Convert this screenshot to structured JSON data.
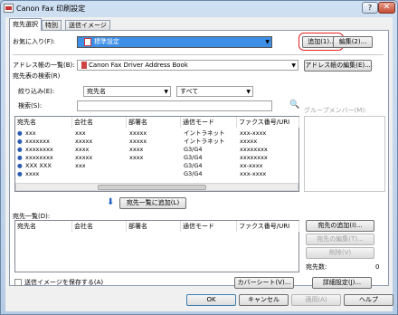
{
  "window": {
    "title": "Canon Fax 印刷設定",
    "help": "?",
    "close": "✕"
  },
  "tabs": [
    {
      "label": "宛先選択"
    },
    {
      "label": "特別"
    },
    {
      "label": "送信イメージ"
    }
  ],
  "favorites": {
    "label": "お気に入り(F):",
    "value": "標準設定",
    "add": "追加(1)...",
    "edit": "編集(2)..."
  },
  "address_book": {
    "label": "アドレス帳の一覧(B):",
    "value": "Canon Fax Driver Address Book",
    "edit": "アドレス帳の編集(E)..."
  },
  "search_section": {
    "title": "宛先表の検索(R)",
    "filter_label": "絞り込み(E):",
    "filter_field": "宛先名",
    "filter_value": "すべて",
    "search_label": "検索(S):",
    "search_value": "",
    "group_label": "グループメンバー(M):"
  },
  "dest_table": {
    "columns": [
      "宛先名",
      "会社名",
      "部署名",
      "通信モード",
      "ファクス番号/URI"
    ],
    "rows": [
      [
        "xxx",
        "xxx",
        "xxxxx",
        "イントラネット",
        "xxx-xxxx"
      ],
      [
        "xxxxxxx",
        "xxxxx",
        "xxxxx",
        "イントラネット",
        "xxxxx"
      ],
      [
        "xxxxxxxx",
        "xxxx",
        "xxxx",
        "G3/G4",
        "xxxxxxxx"
      ],
      [
        "xxxxxxxx",
        "xxxxx",
        "xxxx",
        "G3/G4",
        "xxxxxxxx"
      ],
      [
        "XXX XXX",
        "xxx",
        "",
        "G3/G4",
        "xx-xxxx"
      ],
      [
        "xxxx",
        "",
        "",
        "G3/G4",
        "xxx-xxxx"
      ]
    ]
  },
  "add_to_list": "宛先一覧に追加(L)",
  "dest_list": {
    "title": "宛先一覧(D):",
    "columns": [
      "宛先名",
      "会社名",
      "部署名",
      "通信モード",
      "ファクス番号/URI"
    ],
    "add_dest": "宛先の追加(I)...",
    "edit_dest": "宛先の編集(T)...",
    "delete_dest": "削除(V)",
    "count_label": "宛先数:",
    "count": "0"
  },
  "bottom": {
    "save_image": "送信イメージを保存する(A)",
    "cover_sheet": "カバーシート(V)...",
    "details": "詳細設定(J)...",
    "ok": "OK",
    "cancel": "キャンセル",
    "apply": "適用(A)",
    "help": "ヘルプ"
  },
  "colors": {
    "accent": "#3c8ee6",
    "highlight": "#e02020"
  },
  "icons": [
    "printer-icon",
    "address-book-icon",
    "search-icon",
    "person-icon",
    "down-arrow-icon"
  ]
}
